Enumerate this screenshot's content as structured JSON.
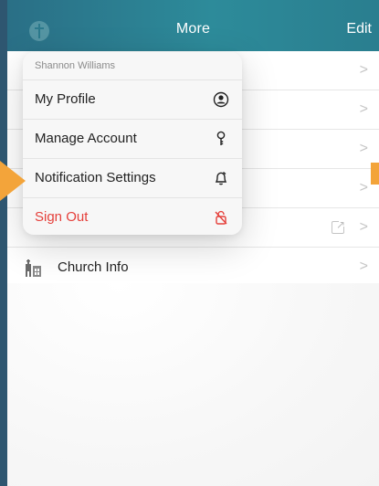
{
  "navbar": {
    "title": "More",
    "edit_label": "Edit",
    "logo_icon": "church-logo-icon"
  },
  "list": {
    "rows": [
      {
        "label": ""
      },
      {
        "label": ""
      },
      {
        "label": ""
      },
      {
        "label": ""
      },
      {
        "label": "",
        "external": true
      },
      {
        "label": "Church Info",
        "icon": "church-icon"
      }
    ],
    "chevron": ">"
  },
  "menu": {
    "header": "Shannon Williams",
    "items": [
      {
        "label": "My Profile",
        "icon": "profile-icon"
      },
      {
        "label": "Manage Account",
        "icon": "key-icon"
      },
      {
        "label": "Notification Settings",
        "icon": "bell-icon"
      },
      {
        "label": "Sign Out",
        "icon": "lock-off-icon",
        "danger": true
      }
    ]
  },
  "colors": {
    "accent": "#f3a43a",
    "navbar": "#2d8b9a",
    "danger": "#e5403b",
    "border": "#2e5670"
  }
}
